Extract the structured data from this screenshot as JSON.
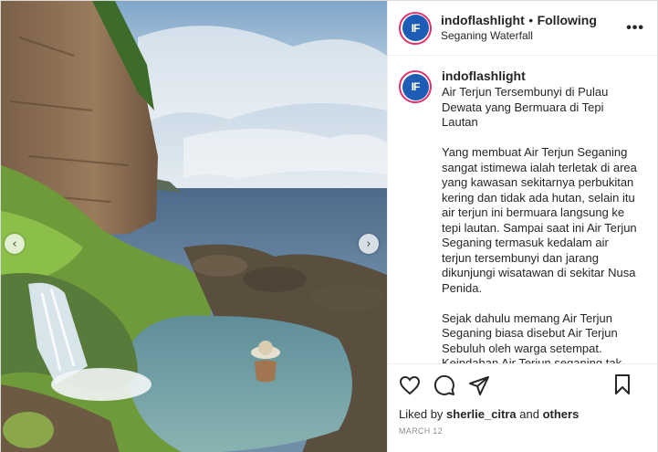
{
  "header": {
    "username": "indoflashlight",
    "separator": "•",
    "follow_status": "Following",
    "location": "Seganing Waterfall",
    "more_label": "•••",
    "avatar_initials": "IF"
  },
  "photo": {
    "prev_label": "‹",
    "next_label": "›"
  },
  "caption": {
    "username": "indoflashlight",
    "paragraphs": [
      "Air Terjun Tersembunyi di Pulau Dewata yang Bermuara di Tepi Lautan",
      "Yang membuat Air Terjun Seganing sangat istimewa ialah terletak di area yang kawasan sekitarnya perbukitan kering dan tidak ada hutan, selain itu air terjun ini bermuara langsung ke tepi lautan. Sampai saat ini Air Terjun Seganing termasuk kedalam air terjun tersembunyi dan jarang dikunjungi wisatawan di sekitar Nusa Penida.",
      "Sejak dahulu memang Air Terjun Seganing biasa disebut Air Terjun Sebuluh oleh warga setempat. Keindahan Air Terjun seganing tak"
    ]
  },
  "actions": {
    "liked_prefix": "Liked by ",
    "liked_user": "sherlie_citra",
    "liked_and": " and ",
    "liked_others": "others",
    "date": "MARCH 12"
  },
  "icons": [
    "heart-icon",
    "comment-icon",
    "share-icon",
    "bookmark-icon",
    "more-icon"
  ],
  "colors": {
    "avatar_ring": "#e1306c",
    "avatar_fill": "#1d5db6",
    "text": "#262626",
    "muted": "#8e8e8e"
  }
}
